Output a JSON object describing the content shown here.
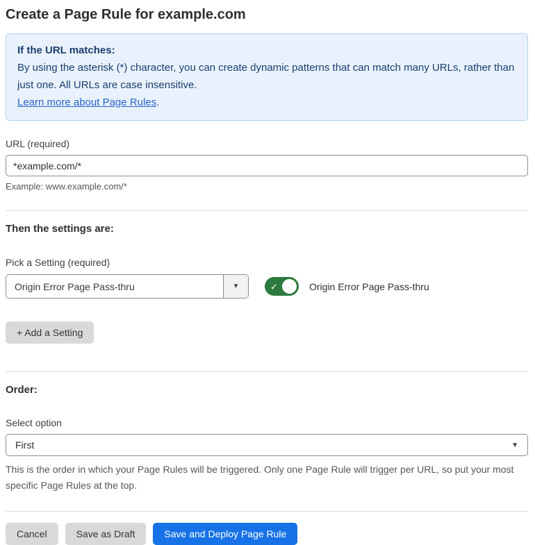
{
  "page": {
    "title": "Create a Page Rule for example.com"
  },
  "info_box": {
    "heading": "If the URL matches:",
    "body": "By using the asterisk (*) character, you can create dynamic patterns that can match many URLs, rather than just one. All URLs are case insensitive.",
    "link_label": "Learn more about Page Rules",
    "link_suffix": "."
  },
  "url_field": {
    "label": "URL (required)",
    "value": "*example.com/*",
    "hint": "Example: www.example.com/*"
  },
  "settings_section": {
    "heading": "Then the settings are:",
    "picker_label": "Pick a Setting (required)",
    "picker_value": "Origin Error Page Pass-thru",
    "toggle_state": "on",
    "toggle_label": "Origin Error Page Pass-thru",
    "add_setting_label": "+ Add a Setting"
  },
  "order_section": {
    "heading": "Order:",
    "select_label": "Select option",
    "select_value": "First",
    "hint": "This is the order in which your Page Rules will be triggered. Only one Page Rule will trigger per URL, so put your most specific Page Rules at the top."
  },
  "footer": {
    "cancel_label": "Cancel",
    "save_draft_label": "Save as Draft",
    "save_deploy_label": "Save and Deploy Page Rule"
  },
  "icons": {
    "dropdown_arrow": "▼",
    "toggle_check": "✓"
  },
  "colors": {
    "info_background": "#e9f2fc",
    "info_border": "#b0d0ee",
    "info_text": "#1b3d6e",
    "link_blue": "#2b62c9",
    "toggle_green": "#2c7a3e",
    "primary_button_blue": "#1672e6",
    "gray_button": "#d9d9d9"
  }
}
